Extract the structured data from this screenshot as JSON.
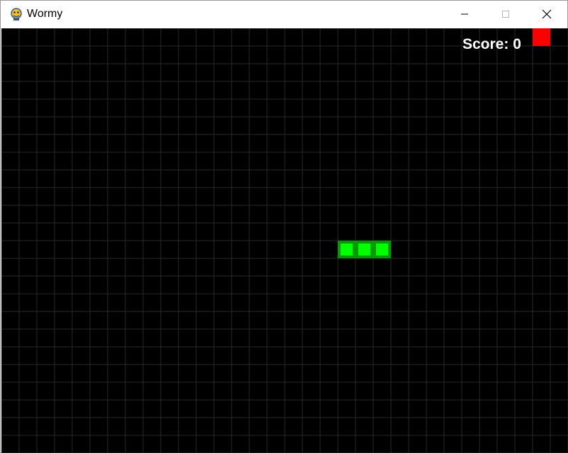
{
  "window": {
    "title": "Wormy",
    "app_icon": "pygame-snake-icon"
  },
  "controls": {
    "minimize_icon": "minimize-icon",
    "maximize_icon": "maximize-icon",
    "close_icon": "close-icon"
  },
  "game": {
    "score_label": "Score: 0",
    "score": 0,
    "grid": {
      "columns": 32,
      "rows": 24
    },
    "worm": {
      "segments": [
        {
          "col": 19,
          "row": 12
        },
        {
          "col": 20,
          "row": 12
        },
        {
          "col": 21,
          "row": 12
        }
      ]
    },
    "apple": {
      "col": 30,
      "row": 0
    },
    "colors": {
      "background": "#000000",
      "grid_line": "#282828",
      "worm_outer": "#009b00",
      "worm_inner": "#00ff00",
      "apple": "#ff0000",
      "text": "#ffffff"
    }
  }
}
